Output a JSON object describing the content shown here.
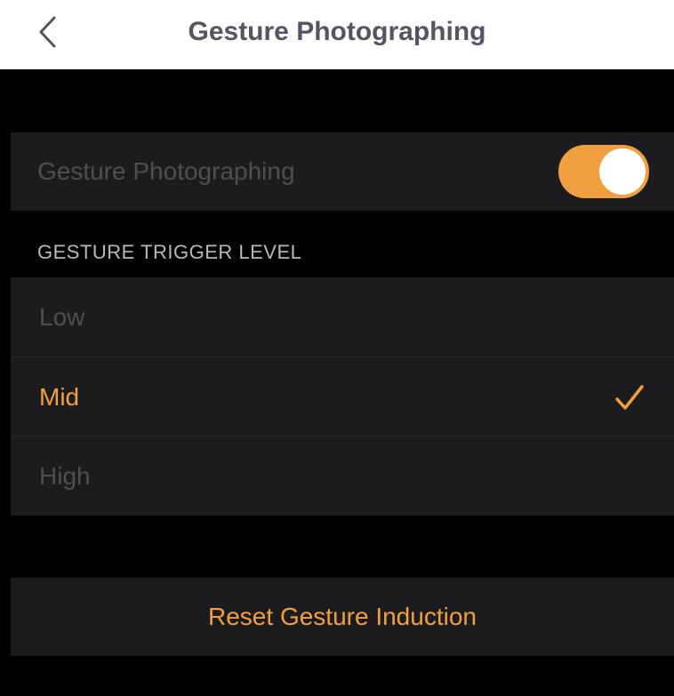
{
  "nav": {
    "back_icon": "chevron-left-icon",
    "title": "Gesture Photographing"
  },
  "gesture_toggle": {
    "label": "Gesture Photographing",
    "enabled": true
  },
  "trigger_level": {
    "header": "GESTURE TRIGGER LEVEL",
    "options": [
      {
        "label": "Low",
        "selected": false
      },
      {
        "label": "Mid",
        "selected": true
      },
      {
        "label": "High",
        "selected": false
      }
    ],
    "selected_icon": "checkmark-icon"
  },
  "reset": {
    "label": "Reset Gesture Induction"
  },
  "colors": {
    "accent": "#f0a040",
    "nav_background": "#ffffff",
    "nav_title": "#545561",
    "page_background": "#000000",
    "card_background": "#1c1c1e",
    "dim_text": "#4f4f52",
    "header_text": "#b9b9bd"
  }
}
